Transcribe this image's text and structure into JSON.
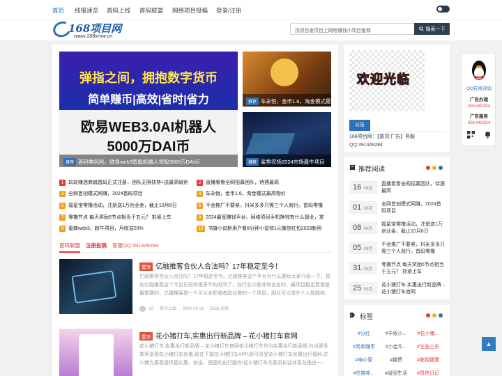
{
  "nav": {
    "items": [
      "首页",
      "线报速览",
      "首码上线",
      "首码联盟",
      "网络项目投稿",
      "登录/注册"
    ]
  },
  "logo": {
    "brand": "168项目网",
    "url": "www.168xmw.cn"
  },
  "search": {
    "placeholder": "找项目发项目上网络赚钱小项目推荐",
    "button_label": "搜索一下"
  },
  "slider": {
    "main": {
      "lines": [
        "弹指之间，拥抱数字货币",
        "简单赚币|高效|省时|省力",
        "欧易WEB3.0AI机器人",
        "5000万DAI币"
      ],
      "tag": "推荐",
      "caption": "首码零风险，欧易web3智能机器人领取5000万DAI币"
    },
    "side": [
      {
        "tag": "推荐",
        "caption": "车永恒，金币1.6，淘金模式最高物价"
      },
      {
        "tag": "推荐",
        "caption": "鲨鱼农场2024市场最牛项目"
      }
    ]
  },
  "news": [
    {
      "n": "1",
      "text": "玖玖赚选商城首码正式注册，团队无限扶持+送最高级别"
    },
    {
      "n": "2",
      "text": "直播看看全网招募团队，待遇最高"
    },
    {
      "n": "3",
      "text": "全网首创模式网赚，2024首码项目"
    },
    {
      "n": "4",
      "text": "车永恒，金币1.6，淘金模式最高物价"
    },
    {
      "n": "5",
      "text": "福星宝零撸活动，注册送1万创业金，截止10月6日"
    },
    {
      "n": "6",
      "text": "不会推广不要紧，抖米多多只需三个人就行。首码零撸"
    },
    {
      "n": "7",
      "text": "零撸节点 每天奖励5节点相当于五元？ 抓紧上车"
    },
    {
      "n": "8",
      "text": "2024最宽赚钱平台，网络项目手机挣钱有什么副业，赏"
    },
    {
      "n": "9",
      "text": "蜜蜂web3，超牛项目，月收益20%"
    },
    {
      "n": "10",
      "text": "书旗小说新用户看8分钟小说领1元微信红包2023新用"
    }
  ],
  "tabs": {
    "items": [
      "首码联盟",
      "注册投稿",
      "客服QQ:391449284"
    ]
  },
  "articles": [
    {
      "tag": "置顶",
      "title": "亿融推客合伙人合法吗？17年稳定至今！",
      "excerpt": "亿融推客合伙人合法吗？17年稳定至今。亿融推客这个平台为什么要给大家介绍一下，首先亿融推客这个平台已经有很多年的时间了，在行业中是非常出名的，最项目稳定靠谱是最重要的，亿融推客是一个可以全职或者副业做的一个项目，副业可以提升个人技能和...",
      "meta": [
        "22",
        "首码上线",
        "2024-09-26",
        "5658 阅读"
      ]
    },
    {
      "tag": "置顶",
      "title": "花小猪打车,实惠出行新品牌 – 花小猪打车官网",
      "excerpt": "花小猪打车,实惠出行新品牌 – 花小猪打车官网花小猪打车作为实惠出行新品牌,为出更多乘客享受花小猪打车优惠,现在下载花小猪打车APP,即可享受花小猪打车优惠出行福利,花小猪为乘客提供更实惠、安全、便捷的出行服务!花小猪打车花客员权益体系在推出一...",
      "meta": [
        "22",
        "首码上线",
        "2024-09-26",
        "阅读"
      ]
    }
  ],
  "sidebar": {
    "welcome": "欢迎光临",
    "notice_tab": "公告",
    "notice_text": "168项目网：【置顶:广告】客服QQ:391449284",
    "recommend_title": "推荐阅读",
    "recommend": [
      {
        "day": "16",
        "month": "08月",
        "title": "直播看看全网招募团队，待遇最高"
      },
      {
        "day": "01",
        "month": "08月",
        "title": "全网首创模式网赚，2024首码项目"
      },
      {
        "day": "08",
        "month": "08月",
        "title": "福星宝零撸活动，注册送1万创业金，截止10月6日"
      },
      {
        "day": "05",
        "month": "09月",
        "title": "不会推广不要紧，抖米多多只需三个人就行。首码零撸"
      },
      {
        "day": "31",
        "month": "08月",
        "title": "零撸节点 每天奖励5节点相当于五元？ 抓紧上车"
      },
      {
        "day": "25",
        "month": "09月",
        "title": "花小猪打车,实惠出行新品牌 – 花小猪打车官网"
      }
    ],
    "tags_title": "标签",
    "tags": [
      "#分红",
      "#丰收小...",
      "#花小猪...",
      "#简单赚币",
      "#小金牛...",
      "#生态三农",
      "#电小家",
      "#趣赞",
      "#乾翔健康",
      "#任推邦...",
      "#省团生活",
      "#悟信日记"
    ]
  },
  "float": {
    "qq_label": "QQ在线咨询",
    "ad1": "广告办理",
    "phone1": "391449284",
    "ad2": "广告服务",
    "phone2": "391449284"
  },
  "colors": {
    "accent": "#2f6fb5",
    "brand_blue": "#1a73c9",
    "red": "#e33a3a",
    "orange": "#f0a020"
  }
}
